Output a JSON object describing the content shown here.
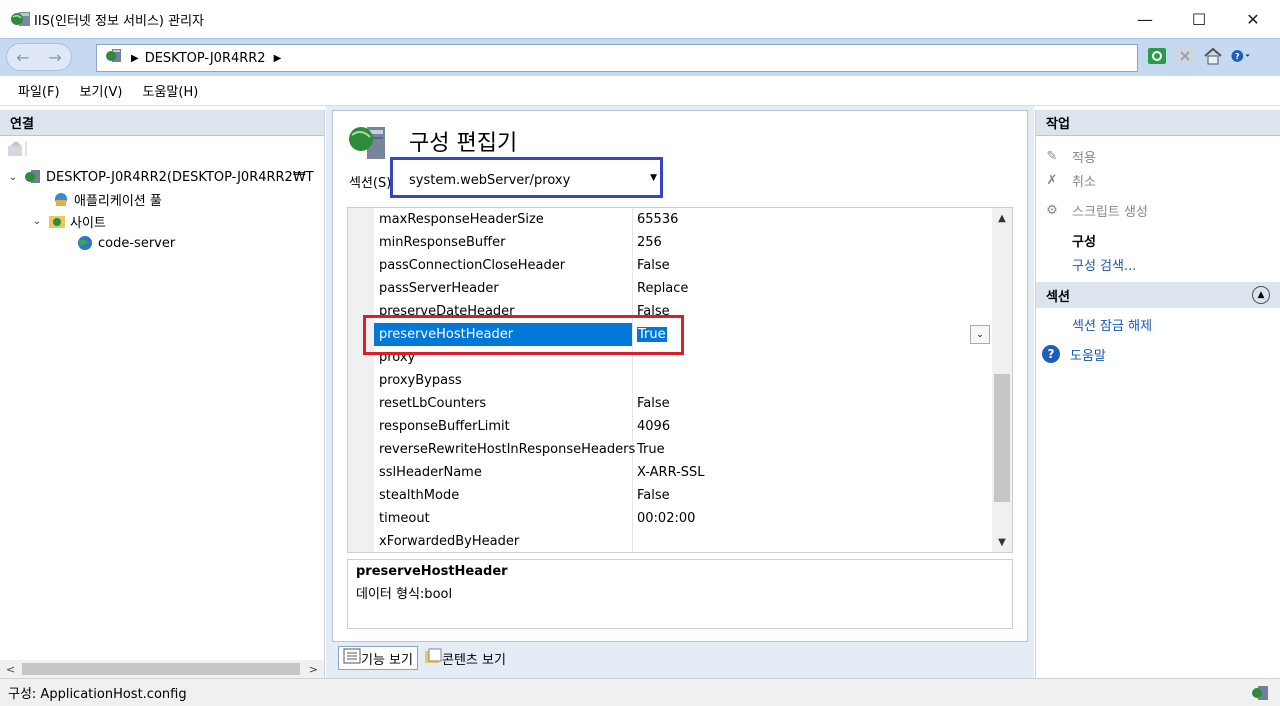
{
  "window": {
    "title": "IIS(인터넷 정보 서비스) 관리자",
    "minimize": "—",
    "maximize": "☐",
    "close": "✕"
  },
  "address": {
    "back": "←",
    "forward": "→",
    "segment": "DESKTOP-J0R4RR2"
  },
  "menu": [
    "파일(F)",
    "보기(V)",
    "도움말(H)"
  ],
  "connections": {
    "header": "연결",
    "tree": [
      {
        "label": "DESKTOP-J0R4RR2(DESKTOP-J0R4RR2₩T",
        "indent": 0,
        "expander": "⌄"
      },
      {
        "label": "애플리케이션 풀",
        "indent": 1,
        "expander": ""
      },
      {
        "label": "사이트",
        "indent": 1,
        "expander": "⌄"
      },
      {
        "label": "code-server",
        "indent": 2,
        "expander": ""
      }
    ],
    "scroll_left": "<",
    "scroll_right": ">"
  },
  "editor": {
    "title": "구성 편집기",
    "section_label": "섹션(S):",
    "section_value": "system.webServer/proxy",
    "rows": [
      {
        "key": "maxResponseHeaderSize",
        "value": "65536"
      },
      {
        "key": "minResponseBuffer",
        "value": "256"
      },
      {
        "key": "passConnectionCloseHeader",
        "value": "False"
      },
      {
        "key": "passServerHeader",
        "value": "Replace"
      },
      {
        "key": "preserveDateHeader",
        "value": "False"
      },
      {
        "key": "preserveHostHeader",
        "value": "True",
        "selected": true
      },
      {
        "key": "proxy",
        "value": ""
      },
      {
        "key": "proxyBypass",
        "value": ""
      },
      {
        "key": "resetLbCounters",
        "value": "False"
      },
      {
        "key": "responseBufferLimit",
        "value": "4096"
      },
      {
        "key": "reverseRewriteHostInResponseHeaders",
        "value": "True"
      },
      {
        "key": "sslHeaderName",
        "value": "X-ARR-SSL"
      },
      {
        "key": "stealthMode",
        "value": "False"
      },
      {
        "key": "timeout",
        "value": "00:02:00"
      },
      {
        "key": "xForwardedByHeader",
        "value": ""
      }
    ],
    "description_title": "preserveHostHeader",
    "description_text": "데이터 형식:bool",
    "tabs": [
      "기능 보기",
      "콘텐츠 보기"
    ]
  },
  "actions": {
    "header": "작업",
    "apply": "적용",
    "cancel": "취소",
    "generate_script": "스크립트 생성",
    "config_head": "구성",
    "config_search": "구성 검색...",
    "section_header": "섹션",
    "unlock_section": "섹션 잠금 해제",
    "help": "도움말"
  },
  "status": {
    "text": "구성: ApplicationHost.config"
  },
  "colors": {
    "selection": "#0078d7",
    "highlight_red": "#d8202c",
    "highlight_blue": "#3645c4",
    "link": "#1a58b0"
  }
}
